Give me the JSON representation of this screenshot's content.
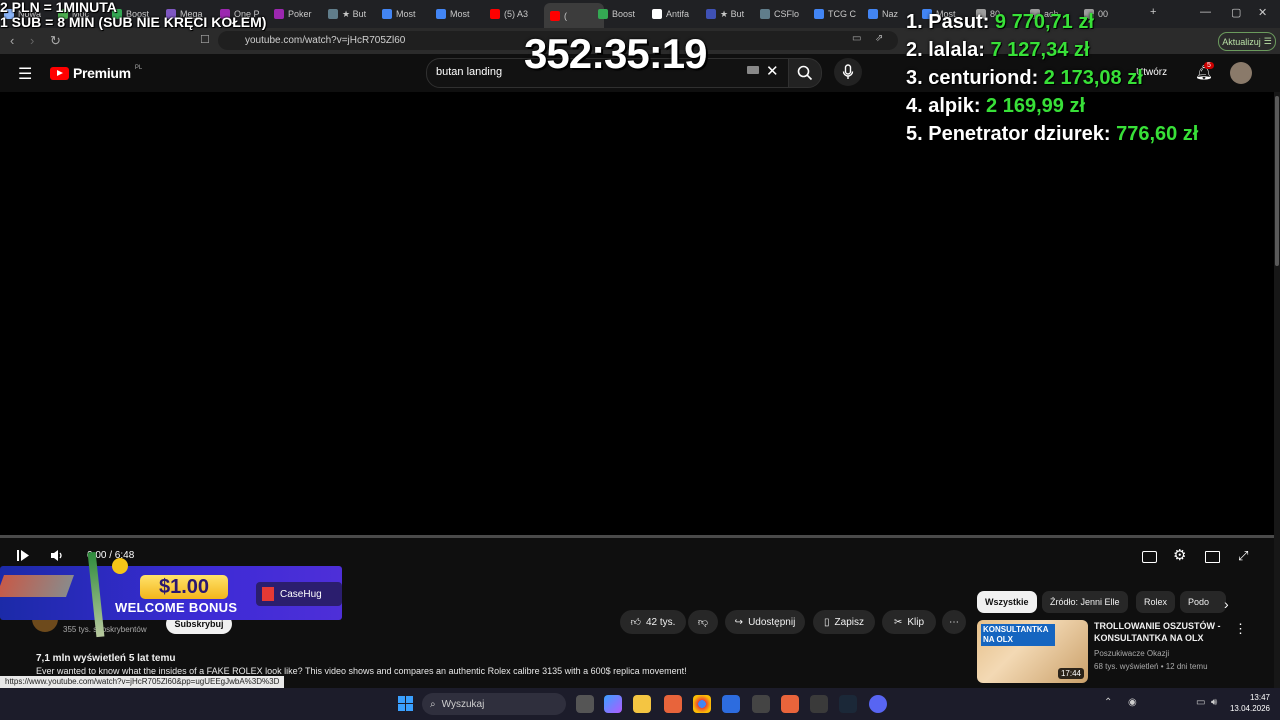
{
  "browser": {
    "tabs": [
      {
        "label": "Nowa",
        "color": "#8ab4f8"
      },
      {
        "label": "Moc",
        "color": "#4caf50"
      },
      {
        "label": "Boost",
        "color": "#34a853"
      },
      {
        "label": "Mega",
        "color": "#7e57c2"
      },
      {
        "label": "One P",
        "color": "#9c27b0"
      },
      {
        "label": "Poker",
        "color": "#9c27b0"
      },
      {
        "label": "★ But",
        "color": "#607d8b"
      },
      {
        "label": "Most",
        "color": "#4285f4"
      },
      {
        "label": "Most",
        "color": "#4285f4"
      },
      {
        "label": "(5) A3",
        "color": "#ff0000"
      },
      {
        "label": "(",
        "color": "#ff0000"
      },
      {
        "label": "Boost",
        "color": "#34a853"
      },
      {
        "label": "Antifa",
        "color": "#ffffff"
      },
      {
        "label": "★ But",
        "color": "#3f51b5"
      },
      {
        "label": "CSFlo",
        "color": "#607d8b"
      },
      {
        "label": "TCG C",
        "color": "#4285f4"
      },
      {
        "label": "Naz",
        "color": "#4285f4"
      },
      {
        "label": "Most",
        "color": "#4285f4"
      },
      {
        "label": "80",
        "color": "#9e9e9e"
      },
      {
        "label": "ach",
        "color": "#9e9e9e"
      },
      {
        "label": "00",
        "color": "#9e9e9e"
      }
    ],
    "url": "youtube.com/watch?v=jHcR705Zl60",
    "update_label": "Aktualizuj",
    "status_url": "https://www.youtube.com/watch?v=jHcR705Zl60&pp=ugUEEgJwbA%3D%3D"
  },
  "youtube": {
    "brand": "Premium",
    "country": "PL",
    "search_value": "butan landing",
    "create_label": "Utwórz",
    "notif_count": "5",
    "time": "0:00 / 6:48",
    "subs": "355 tys. subskrybentów",
    "subscribe_label": "Subskrybuj",
    "likes": "42 tys.",
    "share_label": "Udostępnij",
    "save_label": "Zapisz",
    "clip_label": "Klip",
    "views": "7,1 mln wyświetleń  5 lat temu",
    "description": "Ever wanted to know what the insides of a FAKE ROLEX look like? This video shows and compares an authentic Rolex calibre 3135 with a 600$ replica movement!",
    "chips": [
      "Wszystkie",
      "Źródło: Jenni Elle",
      "Rolex",
      "Podo"
    ],
    "related": {
      "thumb_text": "KONSULTANTKA NA OLX",
      "duration": "17:44",
      "title": "TROLLOWANIE OSZUSTÓW - KONSULTANTKA NA OLX",
      "channel": "Poszukiwacze Okazji",
      "meta": "68 tys. wyświetleń • 12 dni temu"
    }
  },
  "overlay": {
    "donation_line1": "2 PLN =  1MINUTA",
    "donation_line2": "1 SUB = 8 MIN (SUB NIE KRĘCI KOŁEM)",
    "timer": "352:35:19",
    "leaderboard": [
      {
        "name": "1. Pasut:",
        "amount": "9 770,71 zł"
      },
      {
        "name": "2. lalala:",
        "amount": "7 127,34 zł"
      },
      {
        "name": "3. centuriond:",
        "amount": "2 173,08 zł"
      },
      {
        "name": "4. alpik:",
        "amount": "2 169,99 zł"
      },
      {
        "name": "5. Penetrator dziurek:",
        "amount": "776,60 zł"
      }
    ],
    "banner_amount": "$1.00",
    "banner_text": "WELCOME BONUS",
    "banner_brand": "CaseHug"
  },
  "taskbar": {
    "search_placeholder": "Wyszukaj",
    "time": "13:47",
    "date": "13.04.2026"
  }
}
